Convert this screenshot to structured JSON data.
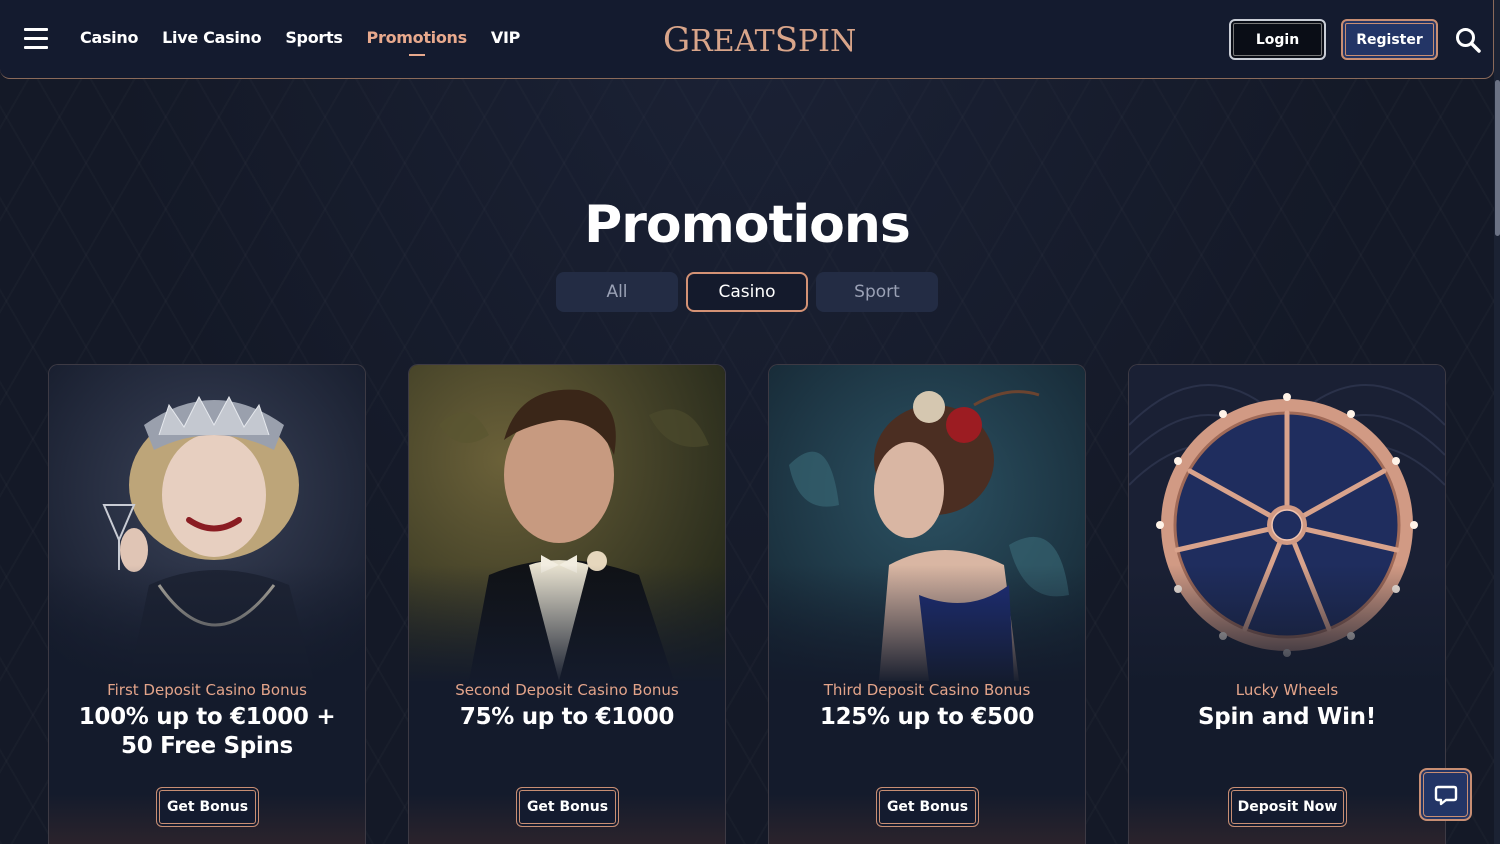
{
  "header": {
    "nav": [
      {
        "label": "Casino",
        "active": false
      },
      {
        "label": "Live Casino",
        "active": false
      },
      {
        "label": "Sports",
        "active": false
      },
      {
        "label": "Promotions",
        "active": true
      },
      {
        "label": "VIP",
        "active": false
      }
    ],
    "logo": {
      "G": "G",
      "reat": "REAT",
      "S": "S",
      "pin": "PIN"
    },
    "login_label": "Login",
    "register_label": "Register"
  },
  "page": {
    "title": "Promotions",
    "tabs": [
      {
        "label": "All",
        "active": false
      },
      {
        "label": "Casino",
        "active": true
      },
      {
        "label": "Sport",
        "active": false
      }
    ]
  },
  "promotions": [
    {
      "subtitle": "First Deposit Casino Bonus",
      "headline": "100% up to €1000 + 50 Free Spins",
      "cta": "Get Bonus",
      "image": "flapper-woman-tiara-cocktail"
    },
    {
      "subtitle": "Second Deposit Casino Bonus",
      "headline": "75% up to €1000",
      "cta": "Get Bonus",
      "image": "gentleman-tuxedo"
    },
    {
      "subtitle": "Third Deposit Casino Bonus",
      "headline": "125% up to €500",
      "cta": "Get Bonus",
      "image": "woman-red-rose-headpiece"
    },
    {
      "subtitle": "Lucky Wheels",
      "headline": "Spin and Win!",
      "cta": "Deposit Now",
      "image": "wheel-of-fortune-gs"
    }
  ],
  "colors": {
    "accent": "#e8a98d",
    "copper": "#c88e73",
    "navy": "#233566",
    "background": "#141927"
  },
  "icons": [
    "hamburger-menu-icon",
    "search-icon",
    "chat-icon"
  ]
}
